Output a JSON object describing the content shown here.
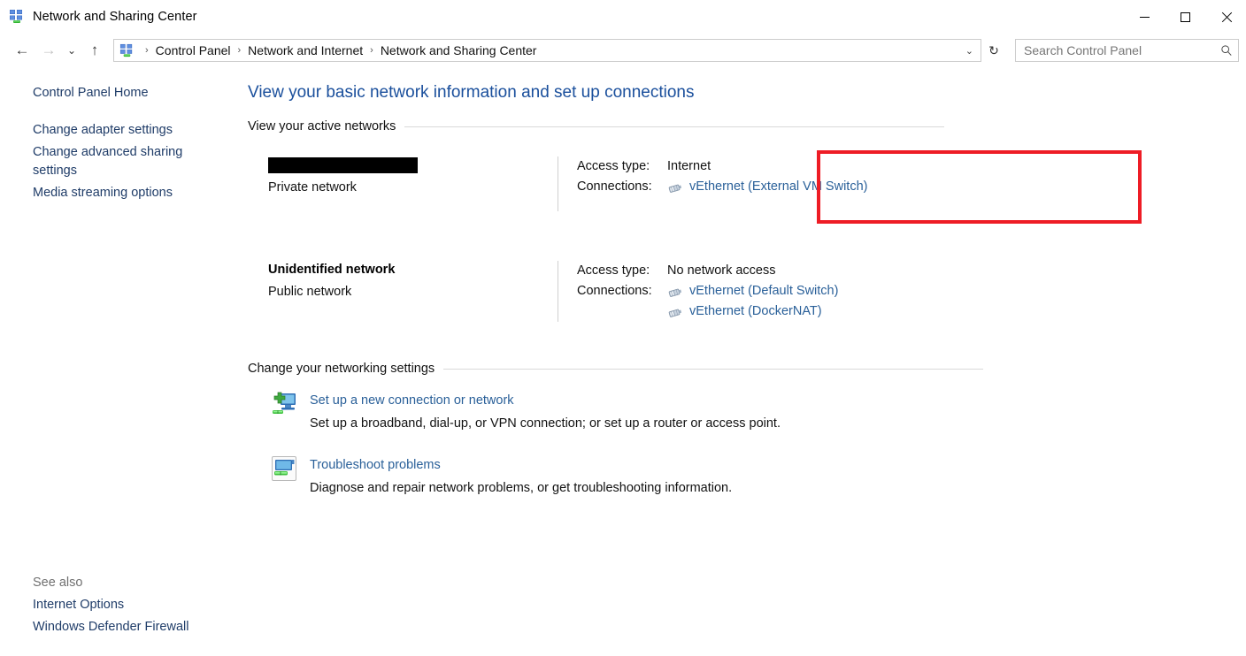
{
  "window": {
    "title": "Network and Sharing Center",
    "icon": "network-sharing-icon",
    "minimize_label": "Minimize",
    "maximize_label": "Maximize",
    "close_label": "Close"
  },
  "nav": {
    "back_glyph": "←",
    "forward_glyph": "→",
    "recent_glyph": "⌄",
    "up_glyph": "↑",
    "address_icon": "network-sharing-icon",
    "breadcrumbs": [
      {
        "label": "Control Panel"
      },
      {
        "label": "Network and Internet"
      },
      {
        "label": "Network and Sharing Center"
      }
    ],
    "separator": "›",
    "dropdown_glyph": "⌄",
    "refresh_glyph": "↻"
  },
  "search": {
    "placeholder": "Search Control Panel",
    "icon": "search-icon"
  },
  "sidebar": {
    "home": "Control Panel Home",
    "items": [
      {
        "label": "Change adapter settings"
      },
      {
        "label": "Change advanced sharing settings"
      },
      {
        "label": "Media streaming options"
      }
    ],
    "see_also_title": "See also",
    "see_also_items": [
      {
        "label": "Internet Options"
      },
      {
        "label": "Windows Defender Firewall"
      }
    ]
  },
  "main": {
    "page_title": "View your basic network information and set up connections",
    "active_networks_heading": "View your active networks",
    "networks": [
      {
        "name": "",
        "name_redacted": true,
        "type": "Private network",
        "access_type_label": "Access type:",
        "access_type_value": "Internet",
        "connections_label": "Connections:",
        "connections": [
          {
            "label": "vEthernet (External VM Switch)",
            "icon": "ethernet-icon"
          }
        ],
        "highlighted": true
      },
      {
        "name": "Unidentified network",
        "name_redacted": false,
        "type": "Public network",
        "access_type_label": "Access type:",
        "access_type_value": "No network access",
        "connections_label": "Connections:",
        "connections": [
          {
            "label": "vEthernet (Default Switch)",
            "icon": "ethernet-icon"
          },
          {
            "label": "vEthernet (DockerNAT)",
            "icon": "ethernet-icon"
          }
        ],
        "highlighted": false
      }
    ],
    "change_settings_heading": "Change your networking settings",
    "tasks": [
      {
        "link": "Set up a new connection or network",
        "description": "Set up a broadband, dial-up, or VPN connection; or set up a router or access point.",
        "icon": "new-connection-icon"
      },
      {
        "link": "Troubleshoot problems",
        "description": "Diagnose and repair network problems, or get troubleshooting information.",
        "icon": "troubleshoot-icon"
      }
    ]
  },
  "colors": {
    "title_blue": "#1a4f9c",
    "link_blue": "#2a6099",
    "sidebar_link": "#1f3c68",
    "highlight_red": "#ee1c25",
    "redaction_black": "#000000"
  }
}
